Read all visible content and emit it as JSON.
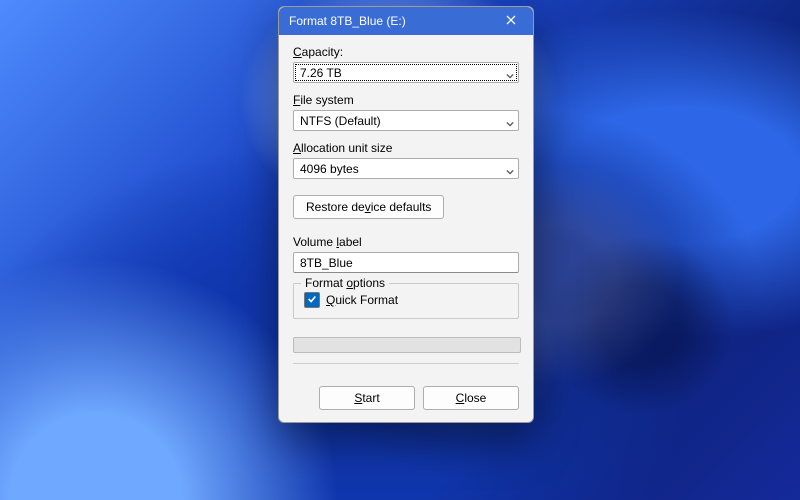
{
  "titlebar": {
    "title": "Format 8TB_Blue (E:)"
  },
  "capacity": {
    "label_pre": "",
    "mn": "C",
    "label_post": "apacity:",
    "value": "7.26 TB"
  },
  "filesystem": {
    "mn": "F",
    "label_post": "ile system",
    "value": "NTFS (Default)"
  },
  "allocation": {
    "mn": "A",
    "label_post": "llocation unit size",
    "value": "4096 bytes"
  },
  "restore_defaults": {
    "pre": "Restore de",
    "mn": "v",
    "post": "ice defaults"
  },
  "volume_label": {
    "pre": "Volume ",
    "mn": "l",
    "post": "abel",
    "value": "8TB_Blue"
  },
  "format_options": {
    "legend_pre": "Format ",
    "legend_mn": "o",
    "legend_post": "ptions",
    "quick_mn": "Q",
    "quick_post": "uick Format",
    "quick_checked": true
  },
  "buttons": {
    "start_mn": "S",
    "start_post": "tart",
    "close_mn": "C",
    "close_post": "lose"
  }
}
